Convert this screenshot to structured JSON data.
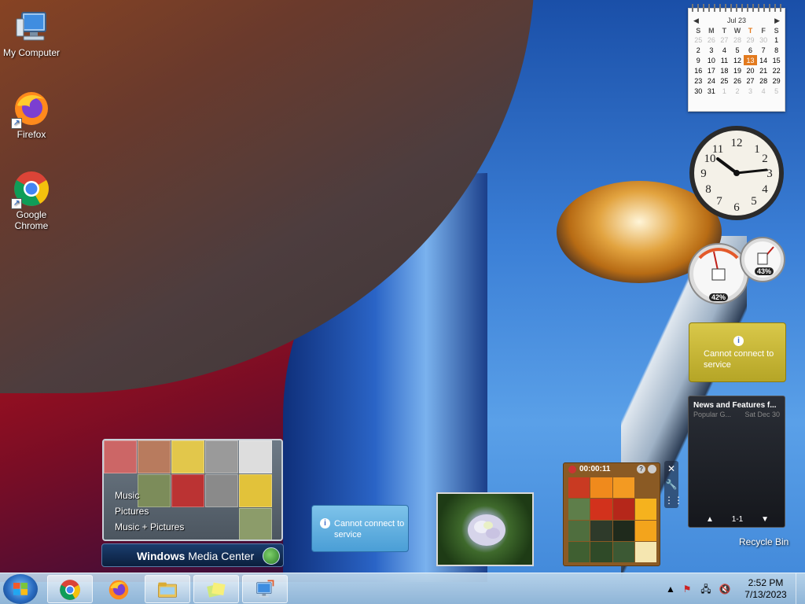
{
  "desktop": {
    "icons": [
      {
        "label": "My Computer",
        "icon": "computer-icon"
      },
      {
        "label": "Firefox",
        "icon": "firefox-icon"
      },
      {
        "label": "Google Chrome",
        "icon": "chrome-icon"
      },
      {
        "label": "Recycle Bin",
        "icon": "recycle-bin-icon"
      }
    ]
  },
  "calendar": {
    "month": "Jul 23",
    "weekdays": [
      "S",
      "M",
      "T",
      "W",
      "T",
      "F",
      "S"
    ],
    "weeks": [
      [
        "25",
        "26",
        "27",
        "28",
        "29",
        "30",
        "1"
      ],
      [
        "2",
        "3",
        "4",
        "5",
        "6",
        "7",
        "8"
      ],
      [
        "9",
        "10",
        "11",
        "12",
        "13",
        "14",
        "15"
      ],
      [
        "16",
        "17",
        "18",
        "19",
        "20",
        "21",
        "22"
      ],
      [
        "23",
        "24",
        "25",
        "26",
        "27",
        "28",
        "29"
      ],
      [
        "30",
        "31",
        "1",
        "2",
        "3",
        "4",
        "5"
      ]
    ],
    "today": "13"
  },
  "cpu_meter": {
    "cpu": "42%",
    "memory": "43%"
  },
  "weather": {
    "message": "Cannot connect to service"
  },
  "feeds": {
    "title": "News and Features f...",
    "source": "Popular G...",
    "date": "Sat Dec 30",
    "pager": "1-1"
  },
  "media_center": {
    "menu": [
      "Music",
      "Pictures",
      "Music + Pictures"
    ],
    "bar_label_bold": "Windows",
    "bar_label_rest": " Media Center"
  },
  "stocks": {
    "message": "Cannot connect to service"
  },
  "puzzle": {
    "timer": "00:00:11"
  },
  "taskbar": {
    "time": "2:52 PM",
    "date": "7/13/2023",
    "pinned": [
      "chrome-icon",
      "firefox-icon",
      "explorer-icon",
      "notes-icon",
      "remote-desktop-icon"
    ]
  },
  "colors": {
    "accent": "#e27a1e",
    "taskbar": "#b4d0e8",
    "weather_gadget": "#c9b836"
  }
}
